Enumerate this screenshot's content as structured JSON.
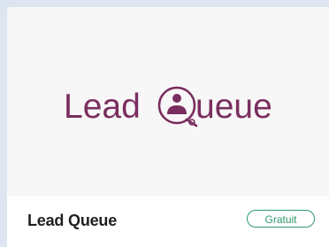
{
  "card": {
    "logo": {
      "text_left": "Lead",
      "text_right": "ueue",
      "brand_color": "#7a2e5e"
    },
    "title": "Lead Queue",
    "badge": "Gratuit",
    "badge_color": "#2d9a6e"
  }
}
